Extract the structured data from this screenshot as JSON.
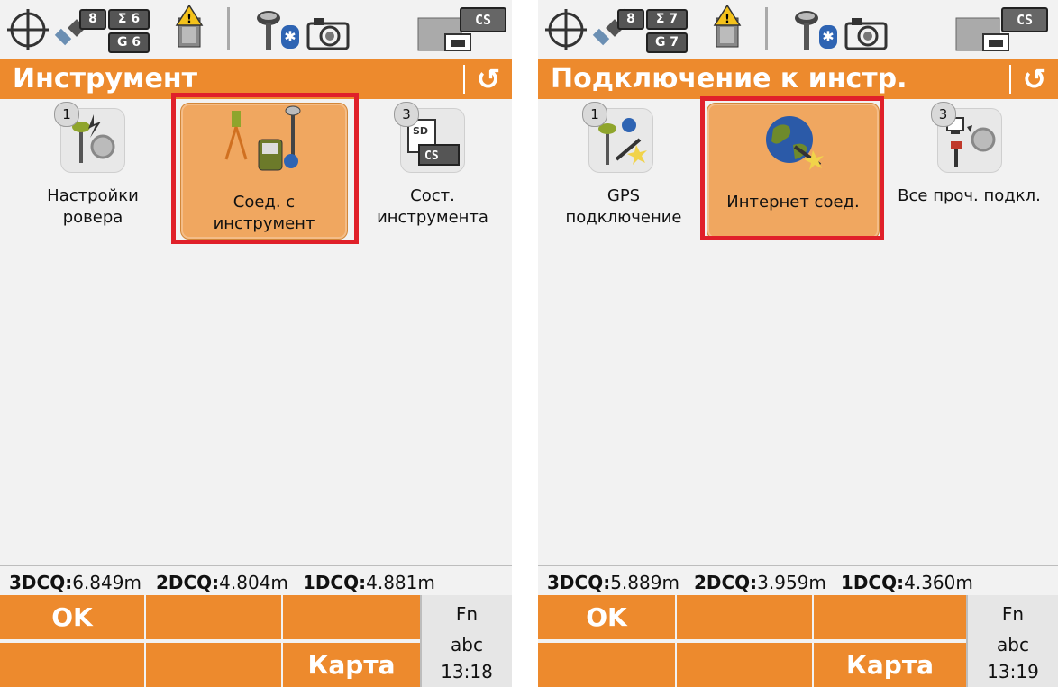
{
  "screens": [
    {
      "status": {
        "sat_total": "8",
        "sigma_label": "Σ 6",
        "gnss_label": "G 6",
        "cs_label": "CS"
      },
      "title": "Инструмент",
      "tiles": [
        {
          "num": "1",
          "label": "Настройки\nровера",
          "icon": "rover-settings-icon"
        },
        {
          "num": "",
          "label": "Соед. с\nинструмент",
          "icon": "connect-instrument-icon"
        },
        {
          "num": "3",
          "label": "Сост.\nинструмента",
          "icon": "instrument-status-icon"
        }
      ],
      "dcq": {
        "k3": "3DCQ:",
        "v3": "6.849m",
        "k2": "2DCQ:",
        "v2": "4.804m",
        "k1": "1DCQ:",
        "v1": "4.881m"
      },
      "softkeys": {
        "f1": "OK",
        "f2": "",
        "f3": "",
        "f4": "",
        "f5": "",
        "f6": "Карта"
      },
      "fn": {
        "fn": "Fn",
        "abc": "abc",
        "time": "13:18"
      }
    },
    {
      "status": {
        "sat_total": "8",
        "sigma_label": "Σ 7",
        "gnss_label": "G 7",
        "cs_label": "CS"
      },
      "title": "Подключение к инстр.",
      "tiles": [
        {
          "num": "1",
          "label": "GPS\nподключение",
          "icon": "gps-connection-icon"
        },
        {
          "num": "",
          "label": "Интернет соед.",
          "icon": "internet-globe-icon"
        },
        {
          "num": "3",
          "label": "Все проч. подкл.",
          "icon": "other-connections-icon"
        }
      ],
      "dcq": {
        "k3": "3DCQ:",
        "v3": "5.889m",
        "k2": "2DCQ:",
        "v2": "3.959m",
        "k1": "1DCQ:",
        "v1": "4.360m"
      },
      "softkeys": {
        "f1": "OK",
        "f2": "",
        "f3": "",
        "f4": "",
        "f5": "",
        "f6": "Карта"
      },
      "fn": {
        "fn": "Fn",
        "abc": "abc",
        "time": "13:19"
      }
    }
  ],
  "colors": {
    "accent": "#ed8a2d",
    "selected_tile": "#f0a760",
    "highlight_frame": "#e0202a",
    "bluetooth": "#2e64b3"
  }
}
